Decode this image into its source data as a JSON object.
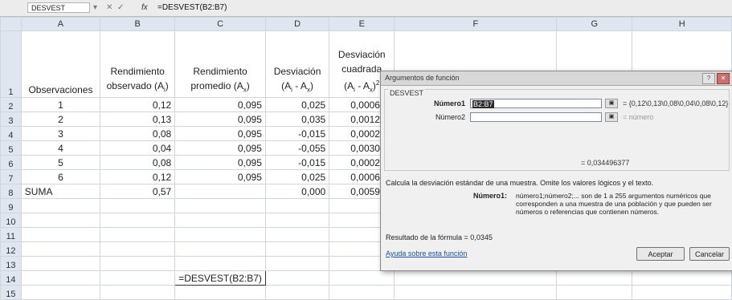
{
  "formula_bar": {
    "name_box": "DESVEST",
    "fx": "fx",
    "formula": "=DESVEST(B2:B7)"
  },
  "columns": [
    "A",
    "B",
    "C",
    "D",
    "E",
    "F",
    "G",
    "H"
  ],
  "row_numbers": [
    "1",
    "2",
    "3",
    "4",
    "5",
    "6",
    "7",
    "8",
    "9",
    "10",
    "11",
    "12",
    "13",
    "14",
    "15"
  ],
  "headers": {
    "a": "Observaciones",
    "b": "Rendimiento observado (Ai)",
    "c": "Rendimiento promedio (Ax)",
    "d": "Desviación (Ai - Ax)",
    "e": "Desviación cuadrada (Ai - Ax)2"
  },
  "rows": [
    {
      "a": "1",
      "b": "0,12",
      "c": "0,095",
      "d": "0,025",
      "e": "0,000625"
    },
    {
      "a": "2",
      "b": "0,13",
      "c": "0,095",
      "d": "0,035",
      "e": "0,001225"
    },
    {
      "a": "3",
      "b": "0,08",
      "c": "0,095",
      "d": "-0,015",
      "e": "0,000225"
    },
    {
      "a": "4",
      "b": "0,04",
      "c": "0,095",
      "d": "-0,055",
      "e": "0,003025"
    },
    {
      "a": "5",
      "b": "0,08",
      "c": "0,095",
      "d": "-0,015",
      "e": "0,000225"
    },
    {
      "a": "6",
      "b": "0,12",
      "c": "0,095",
      "d": "0,025",
      "e": "0,000625"
    }
  ],
  "sum_row": {
    "a": "SUMA",
    "b": "0,57",
    "c": "",
    "d": "0,000",
    "e": "0,005950"
  },
  "cell_c14": "=DESVEST(B2:B7)",
  "dialog": {
    "title": "Argumentos de función",
    "function_name": "DESVEST",
    "arg1_label": "Número1",
    "arg1_value": "B2:B7",
    "arg1_result": "= {0,12\\0,13\\0,08\\0,04\\0,08\\0,12}",
    "arg2_label": "Número2",
    "arg2_result": "= número",
    "result_inline": "= 0,034496377",
    "description": "Calcula la desviación estándar de una muestra. Omite los valores lógicos y el texto.",
    "num1_label": "Número1:",
    "num1_desc": "número1;número2;... son de 1 a 255 argumentos numéricos que corresponden a una muestra de una población y que pueden ser números o referencias que contienen números.",
    "formula_result": "Resultado de la fórmula =  0,0345",
    "help_link": "Ayuda sobre esta función",
    "ok": "Aceptar",
    "cancel": "Cancelar"
  }
}
